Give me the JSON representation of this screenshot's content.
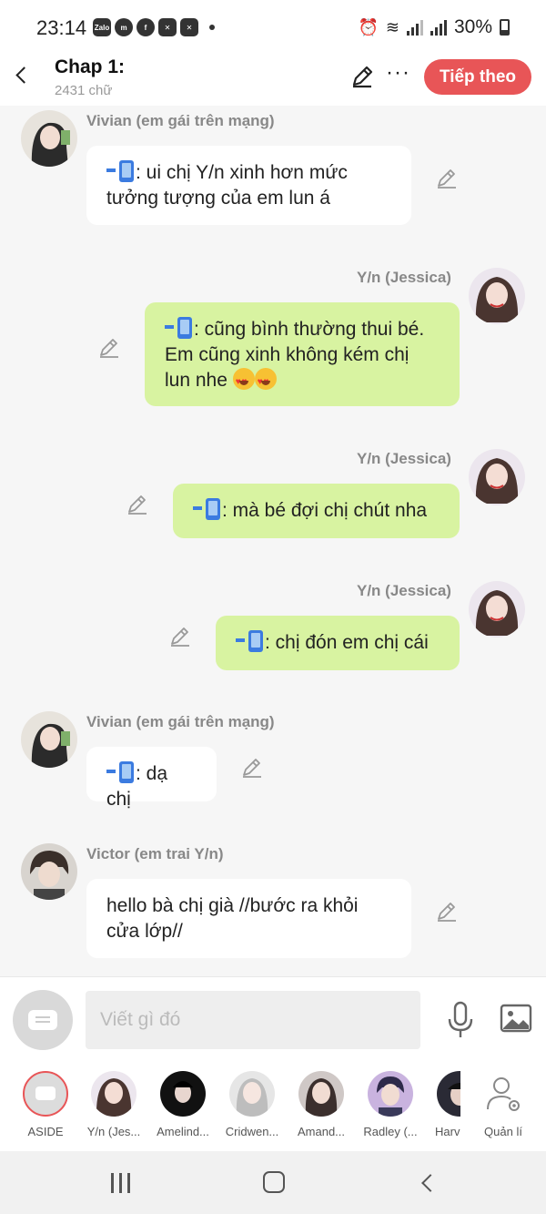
{
  "status_bar": {
    "time": "23:14",
    "battery": "30%",
    "app_icons": [
      "Zalo",
      "messenger-icon",
      "facebook-icon",
      "capcut-icon",
      "capcut-icon"
    ]
  },
  "header": {
    "title": "Chap 1:",
    "word_count": "2431 chữ",
    "next_label": "Tiếp theo"
  },
  "messages": [
    {
      "side": "left",
      "sender": "Vivian (em gái trên mạng)",
      "text_line1": ": ui chị Y/n xinh hơn mức",
      "text_line2": "tưởng tượng của em lun á"
    },
    {
      "side": "right",
      "sender": "Y/n (Jessica)",
      "text_line1": ": cũng bình thường thui bé.",
      "text_line2": "Em cũng xinh không kém chị",
      "text_line3": "lun nhe"
    },
    {
      "side": "right",
      "sender": "Y/n (Jessica)",
      "text_line1": ": mà bé đợi chị chút nha"
    },
    {
      "side": "right",
      "sender": "Y/n (Jessica)",
      "text_line1": ": chị đón em chị cái"
    },
    {
      "side": "left",
      "sender": "Vivian (em gái trên mạng)",
      "text_line1": ": dạ chị"
    },
    {
      "side": "left",
      "sender": "Victor (em trai Y/n)",
      "text_line1": "hello bà chị già //bước ra khỏi",
      "text_line2": "cửa lớp//"
    }
  ],
  "input": {
    "placeholder": "Viết gì đó"
  },
  "characters": [
    {
      "name": "ASIDE"
    },
    {
      "name": "Y/n (Jes..."
    },
    {
      "name": "Amelind..."
    },
    {
      "name": "Cridwen..."
    },
    {
      "name": "Amand..."
    },
    {
      "name": "Radley (..."
    },
    {
      "name": "Harv"
    },
    {
      "name": "Quản lí"
    }
  ],
  "colors": {
    "accent": "#e85557",
    "right_bubble": "#d8f3a1",
    "left_bubble": "#ffffff",
    "background": "#f6f6f6"
  }
}
